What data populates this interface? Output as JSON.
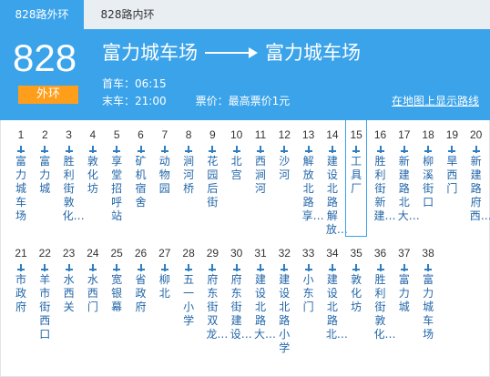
{
  "tabs": [
    {
      "label": "828路外环"
    },
    {
      "label": "828路内环"
    }
  ],
  "header": {
    "route_number": "828",
    "direction": "外环",
    "from": "富力城车场",
    "to": "富力城车场",
    "first_bus": "首车：06:15",
    "last_bus": "末车：21:00",
    "fare": "票价：最高票价1元",
    "map_link": "在地图上显示路线"
  },
  "stops": [
    {
      "num": "1",
      "name": "富力城车场"
    },
    {
      "num": "2",
      "name": "富力城"
    },
    {
      "num": "3",
      "name": "胜利街敦化…"
    },
    {
      "num": "4",
      "name": "敦化坊"
    },
    {
      "num": "5",
      "name": "享堂招呼站"
    },
    {
      "num": "6",
      "name": "矿机宿舍"
    },
    {
      "num": "7",
      "name": "动物园"
    },
    {
      "num": "8",
      "name": "涧河桥"
    },
    {
      "num": "9",
      "name": "花园后街"
    },
    {
      "num": "10",
      "name": "北宫"
    },
    {
      "num": "11",
      "name": "西涧河"
    },
    {
      "num": "12",
      "name": "沙河"
    },
    {
      "num": "13",
      "name": "解放北路享…"
    },
    {
      "num": "14",
      "name": "建设北路解放…"
    },
    {
      "num": "15",
      "name": "工具厂"
    },
    {
      "num": "16",
      "name": "胜利街新建…"
    },
    {
      "num": "17",
      "name": "新建路北大…"
    },
    {
      "num": "18",
      "name": "柳溪街口"
    },
    {
      "num": "19",
      "name": "旱西门"
    },
    {
      "num": "20",
      "name": "新建路府西…"
    },
    {
      "num": "21",
      "name": "市政府"
    },
    {
      "num": "22",
      "name": "羊市街西口"
    },
    {
      "num": "23",
      "name": "水西关"
    },
    {
      "num": "24",
      "name": "水西门"
    },
    {
      "num": "25",
      "name": "宽银幕"
    },
    {
      "num": "26",
      "name": "省政府"
    },
    {
      "num": "27",
      "name": "柳北"
    },
    {
      "num": "28",
      "name": "五一小学"
    },
    {
      "num": "29",
      "name": "府东街双龙…"
    },
    {
      "num": "30",
      "name": "府东街建设…"
    },
    {
      "num": "31",
      "name": "建设北路大…"
    },
    {
      "num": "32",
      "name": "建设北路小学"
    },
    {
      "num": "33",
      "name": "小东门"
    },
    {
      "num": "34",
      "name": "建设北路北…"
    },
    {
      "num": "35",
      "name": "敦化坊"
    },
    {
      "num": "36",
      "name": "胜利街敦化…"
    },
    {
      "num": "37",
      "name": "富力城"
    },
    {
      "num": "38",
      "name": "富力城车场"
    }
  ]
}
